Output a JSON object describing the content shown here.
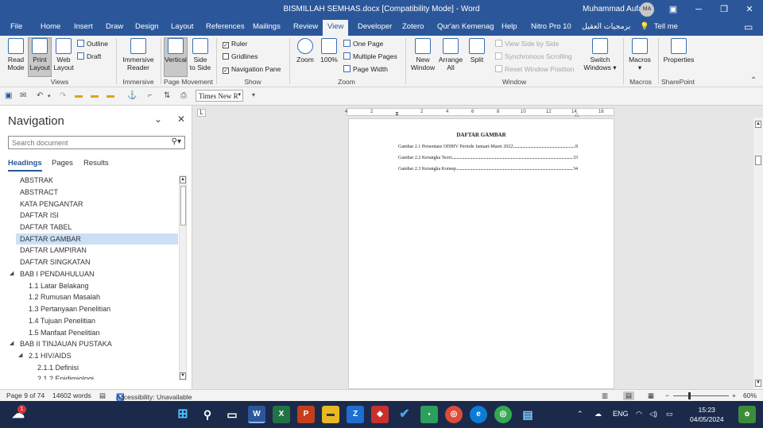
{
  "titlebar": {
    "title": "BISMILLAH SEMHAS.docx [Compatibility Mode] - Word",
    "user_name": "Muhammad Aufa",
    "avatar_initials": "MA"
  },
  "menu": {
    "tabs": [
      "File",
      "Home",
      "Insert",
      "Draw",
      "Design",
      "Layout",
      "References",
      "Mailings",
      "Review",
      "View",
      "Developer",
      "Zotero",
      "Qur'an Kemenag",
      "Help",
      "Nitro Pro 10",
      "برمجيات العقيل"
    ],
    "active_tab": "View",
    "tell_me": "Tell me"
  },
  "ribbon": {
    "read_mode": "Read Mode",
    "read_mode_l1": "Read",
    "read_mode_l2": "Mode",
    "print_layout_l1": "Print",
    "print_layout_l2": "Layout",
    "web_layout_l1": "Web",
    "web_layout_l2": "Layout",
    "outline": "Outline",
    "draft": "Draft",
    "views_group": "Views",
    "immersive_reader_l1": "Immersive",
    "immersive_reader_l2": "Reader",
    "immersive_group": "Immersive",
    "vertical": "Vertical",
    "side_to_side_l1": "Side",
    "side_to_side_l2": "to Side",
    "page_movement_group": "Page Movement",
    "ruler": "Ruler",
    "gridlines": "Gridlines",
    "navigation_pane": "Navigation Pane",
    "show_group": "Show",
    "zoom": "Zoom",
    "hundred": "100%",
    "one_page": "One Page",
    "multiple_pages": "Multiple Pages",
    "page_width": "Page Width",
    "zoom_group": "Zoom",
    "new_window_l1": "New",
    "new_window_l2": "Window",
    "arrange_all_l1": "Arrange",
    "arrange_all_l2": "All",
    "split": "Split",
    "view_side_by_side": "View Side by Side",
    "sync_scrolling": "Synchronous Scrolling",
    "reset_window_position": "Reset Window Position",
    "switch_windows_l1": "Switch",
    "switch_windows_l2": "Windows",
    "window_group": "Window",
    "macros": "Macros",
    "macros_group": "Macros",
    "properties": "Properties",
    "sharepoint_group": "SharePoint"
  },
  "qat": {
    "font_name": "Times New R"
  },
  "navigation": {
    "title": "Navigation",
    "search_placeholder": "Search document",
    "tabs": [
      "Headings",
      "Pages",
      "Results"
    ],
    "headings": [
      {
        "label": "ABSTRAK",
        "level": 1,
        "expander": false
      },
      {
        "label": "ABSTRACT",
        "level": 1,
        "expander": false
      },
      {
        "label": "KATA PENGANTAR",
        "level": 1,
        "expander": false
      },
      {
        "label": "DAFTAR ISI",
        "level": 1,
        "expander": false
      },
      {
        "label": "DAFTAR TABEL",
        "level": 1,
        "expander": false
      },
      {
        "label": "DAFTAR GAMBAR",
        "level": 1,
        "expander": false,
        "selected": true
      },
      {
        "label": "DAFTAR LAMPIRAN",
        "level": 1,
        "expander": false
      },
      {
        "label": "DAFTAR SINGKATAN",
        "level": 1,
        "expander": false
      },
      {
        "label": "BAB I  PENDAHULUAN",
        "level": 1,
        "expander": true
      },
      {
        "label": "1.1 Latar Belakang",
        "level": 2,
        "expander": false
      },
      {
        "label": "1.2 Rumusan Masalah",
        "level": 2,
        "expander": false
      },
      {
        "label": "1.3 Pertanyaan Penelitian",
        "level": 2,
        "expander": false
      },
      {
        "label": "1.4 Tujuan Penelitian",
        "level": 2,
        "expander": false
      },
      {
        "label": "1.5 Manfaat Penelitian",
        "level": 2,
        "expander": false
      },
      {
        "label": "BAB II TINJAUAN PUSTAKA",
        "level": 1,
        "expander": true
      },
      {
        "label": "2.1 HIV/AIDS",
        "level": 2,
        "expander": true
      },
      {
        "label": "2.1.1 Definisi",
        "level": 3,
        "expander": false
      },
      {
        "label": "2.1.2 Epidimiologi",
        "level": 3,
        "expander": false
      }
    ]
  },
  "document": {
    "title": "DAFTAR GAMBAR",
    "entries": [
      {
        "text": "Gambar 2.1 Persentase ODHIV Periode Januari-Maret 2022",
        "page": "8"
      },
      {
        "text": "Gambar 2.2 Kerangka Teori",
        "page": "33"
      },
      {
        "text": "Gambar 2.3 Kerangka Konsep",
        "page": "34"
      }
    ],
    "ruler_numbers": [
      "4",
      "2",
      "2",
      "4",
      "6",
      "8",
      "10",
      "12",
      "14",
      "16"
    ],
    "ruler_tab": "L"
  },
  "statusbar": {
    "page": "Page 9 of 74",
    "words": "14602 words",
    "accessibility": "Accessibility: Unavailable",
    "zoom": "60%"
  },
  "taskbar": {
    "language": "ENG",
    "time": "15:23",
    "date": "04/05/2024",
    "notification_badge": "1"
  }
}
